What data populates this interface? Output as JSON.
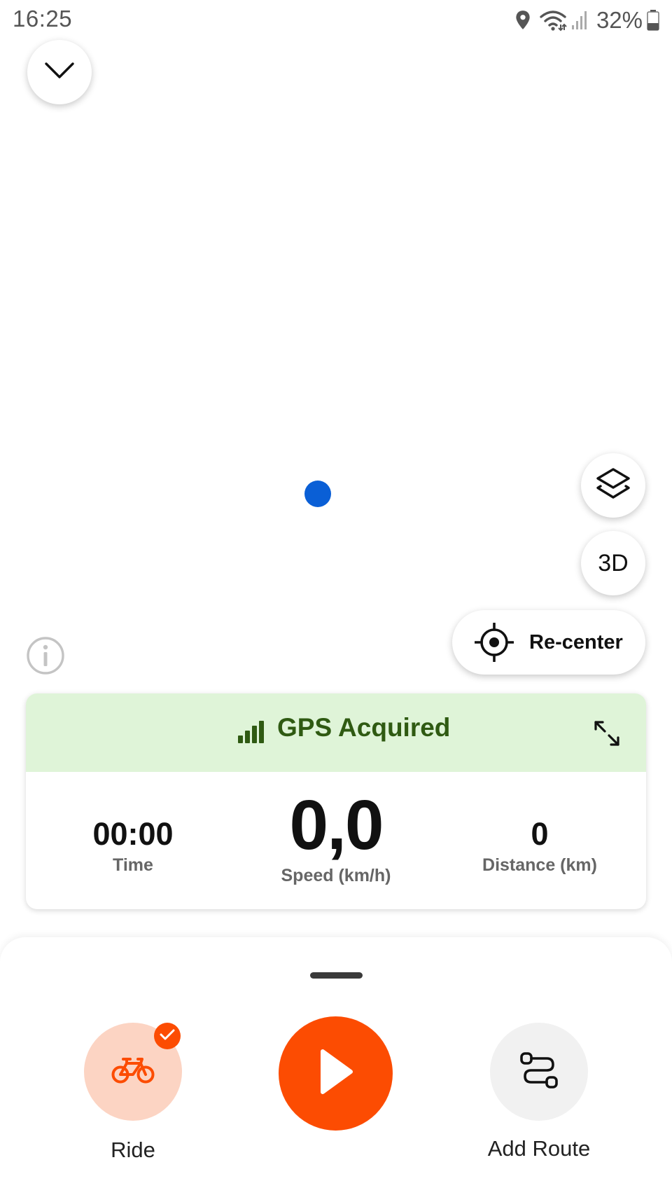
{
  "status_bar": {
    "time": "16:25",
    "battery": "32%",
    "icons": [
      "location-icon",
      "wifi-icon",
      "cell-signal-icon",
      "battery-icon"
    ]
  },
  "map": {
    "collapse_icon": "chevron-down-icon",
    "layers_icon": "layers-icon",
    "three_d_label": "3D",
    "recenter_label": "Re-center",
    "recenter_icon": "crosshair-icon",
    "location_dot_color": "#0a5fd6",
    "info_icon": "info-icon"
  },
  "stats_card": {
    "gps_status": "GPS Acquired",
    "gps_banner_color": "#dff4d8",
    "gps_text_color": "#2f5a12",
    "time_value": "00:00",
    "time_label": "Time",
    "speed_value": "0,0",
    "speed_label": "Speed (km/h)",
    "distance_value": "0",
    "distance_label": "Distance (km)"
  },
  "bottom_sheet": {
    "sport_label": "Ride",
    "sport_icon": "bike-icon",
    "add_route_label": "Add Route",
    "accent_color": "#fc4c02"
  }
}
